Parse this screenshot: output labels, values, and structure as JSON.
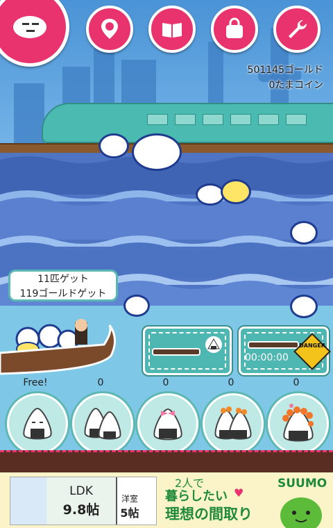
{
  "hud": {
    "gold": "501145ゴールド",
    "coins": "0たまコイン"
  },
  "top_buttons": [
    {
      "name": "menu-button",
      "icon": "fish-face-icon"
    },
    {
      "name": "map-button",
      "icon": "map-pin-icon"
    },
    {
      "name": "book-button",
      "icon": "open-book-icon"
    },
    {
      "name": "bag-button",
      "icon": "bag-icon"
    },
    {
      "name": "settings-button",
      "icon": "wrench-icon"
    }
  ],
  "catch_bubble": {
    "line1": "11匹ゲット",
    "line2": "119ゴールドゲット"
  },
  "panels": {
    "bait_timer": {
      "bar_fill": 0.0
    },
    "danger_timer": {
      "time": "00:00:00",
      "badge": "DANGER",
      "bar_fill": 0.0
    }
  },
  "bait_counts": [
    "Free!",
    "0",
    "0",
    "0",
    "0"
  ],
  "bait_slots": [
    {
      "name": "bait-slot-1",
      "icon": "onigiri-icon"
    },
    {
      "name": "bait-slot-2",
      "icon": "double-onigiri-icon"
    },
    {
      "name": "bait-slot-3",
      "icon": "onigiri-ribbon-icon"
    },
    {
      "name": "bait-slot-4",
      "icon": "onigiri-salmon-roe-icon"
    },
    {
      "name": "bait-slot-5",
      "icon": "onigiri-ikura-icon"
    }
  ],
  "ad": {
    "room_type": "LDK",
    "room_size": "9.8帖",
    "second_room": "洋室",
    "second_size": "5帖",
    "headline_small": "2人で",
    "headline_line2": "暮らしたい",
    "headline_line3": "理想の間取り",
    "brand": "SUUMO",
    "colors": {
      "headline": "#1f8a3a",
      "brand": "#1f8a3a",
      "heart": "#e8336f"
    }
  }
}
